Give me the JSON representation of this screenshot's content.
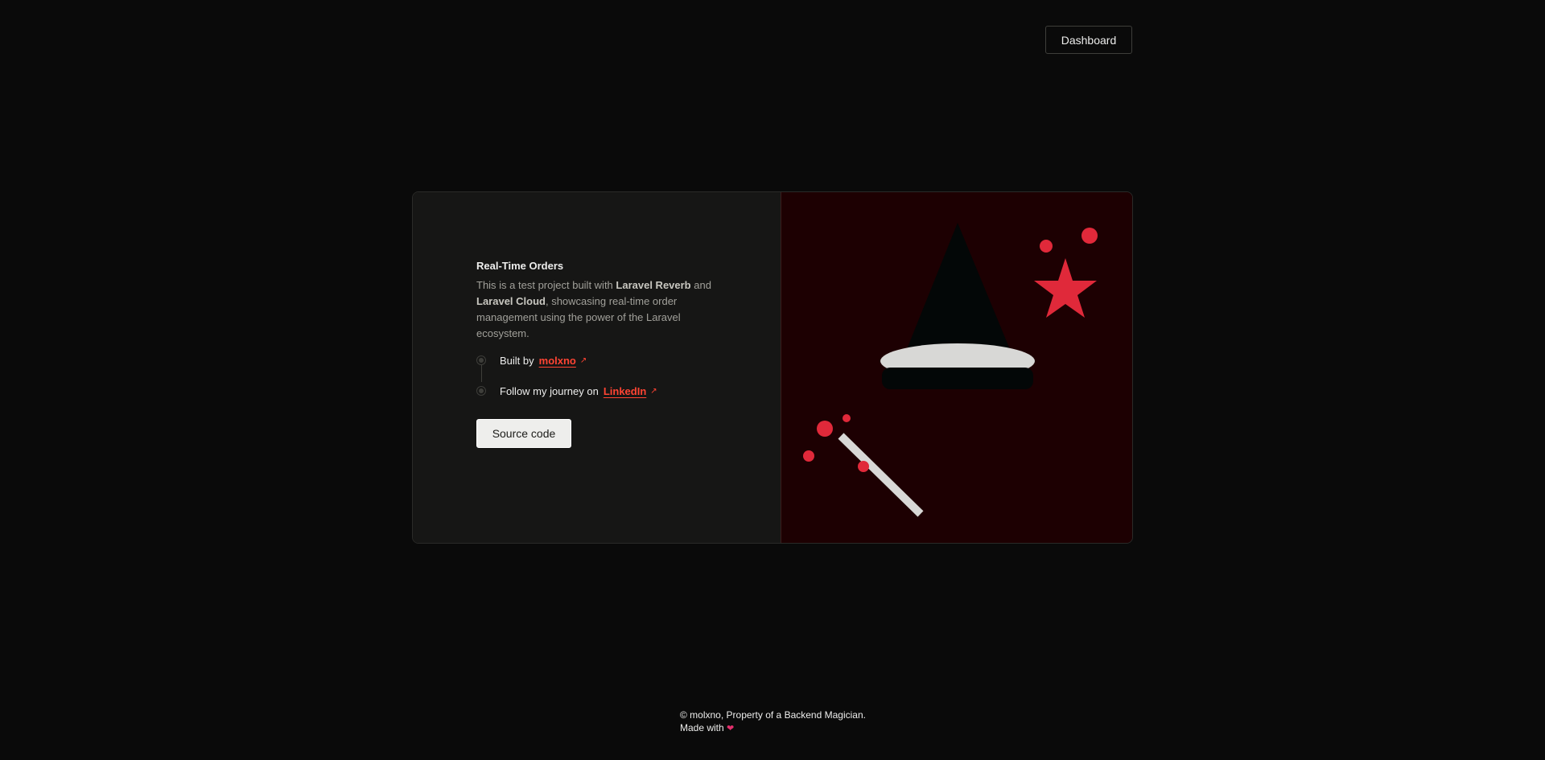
{
  "header": {
    "dashboard_label": "Dashboard"
  },
  "card": {
    "title": "Real-Time Orders",
    "description": {
      "part1": "This is a test project built with ",
      "bold1": "Laravel Reverb",
      "part2": " and ",
      "bold2": "Laravel Cloud",
      "part3": ", showcasing real-time order management using the power of the Laravel ecosystem."
    },
    "steps": [
      {
        "text": "Built by",
        "link_label": "molxno",
        "link_icon": "arrow-up-right-icon"
      },
      {
        "text": "Follow my journey on",
        "link_label": "LinkedIn",
        "link_icon": "arrow-up-right-icon"
      }
    ],
    "source_button_label": "Source code"
  },
  "footer": {
    "line1": "© molxno, Property of a Backend Magician.",
    "line2": "Made with",
    "heart": "❤"
  },
  "colors": {
    "background": "#0a0a0a",
    "card_left": "#161615",
    "card_right": "#1d0002",
    "accent_red": "#ff4433",
    "illustration_red": "#e0293a"
  }
}
